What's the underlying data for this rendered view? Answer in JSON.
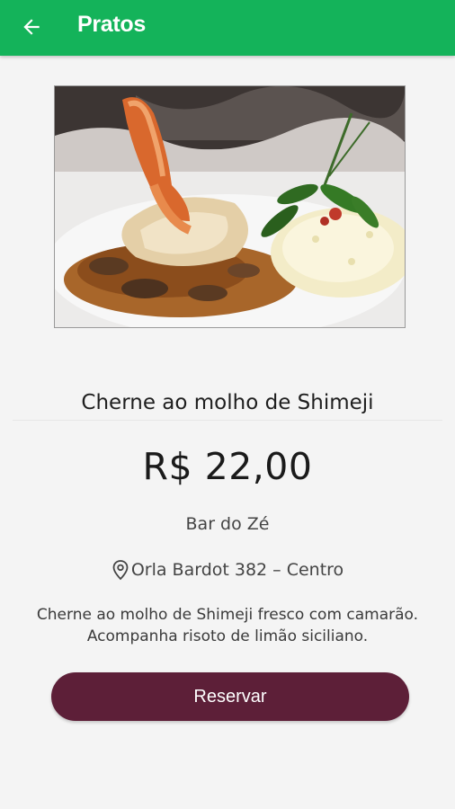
{
  "appbar": {
    "title": "Pratos",
    "back_icon": "arrow-left-icon",
    "color": "#14b35a"
  },
  "dish": {
    "image_subject": "fish-with-shrimp-and-risotto",
    "name": "Cherne ao molho de Shimeji",
    "price": "R$ 22,00",
    "restaurant": "Bar do Zé",
    "location_icon": "location-pin-icon",
    "address": "Orla Bardot 382 – Centro",
    "description": "Cherne ao molho de Shimeji fresco com camarão. Acompanha risoto de limão siciliano."
  },
  "actions": {
    "reserve_label": "Reservar",
    "reserve_color": "#5d1f38"
  }
}
